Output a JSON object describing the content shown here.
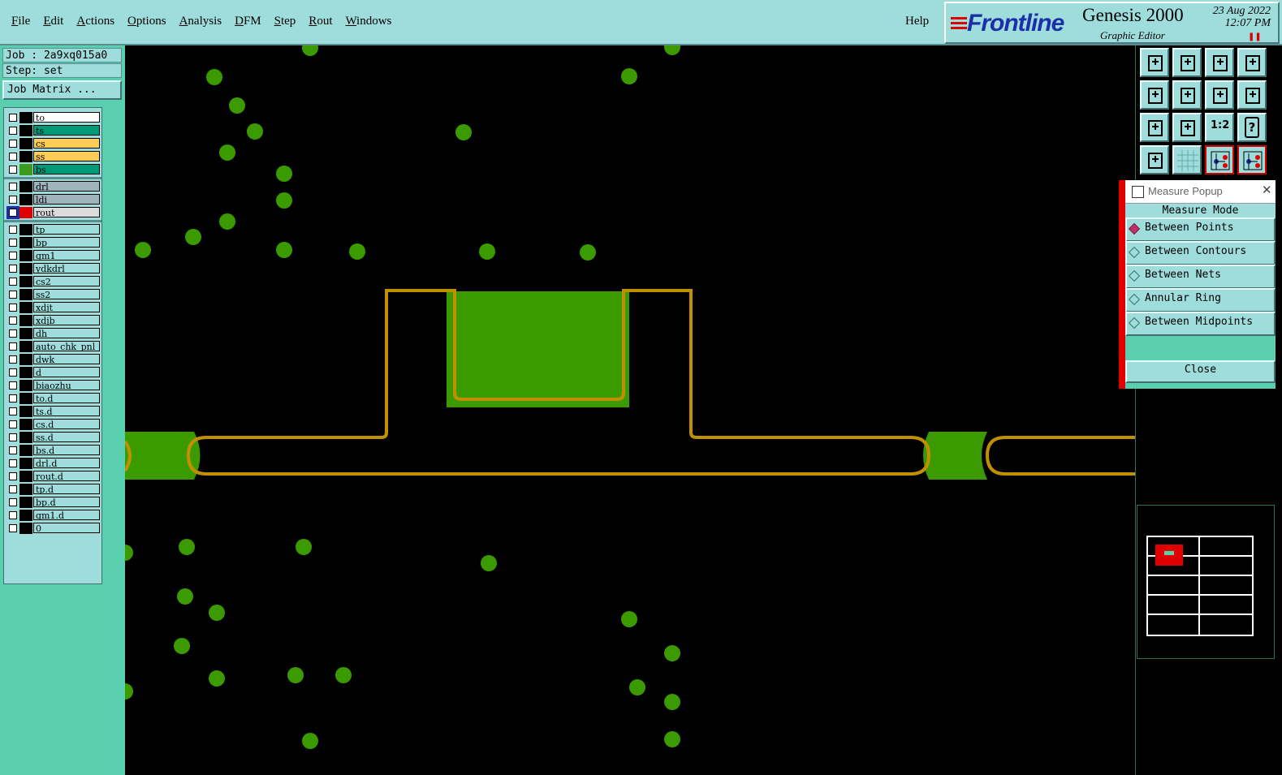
{
  "menubar": {
    "items": [
      "File",
      "Edit",
      "Actions",
      "Options",
      "Analysis",
      "DFM",
      "Step",
      "Rout",
      "Windows"
    ],
    "help": "Help"
  },
  "branding": {
    "logo": "Frontline",
    "app_name": "Genesis 2000",
    "subtitle": "Graphic Editor",
    "date": "23 Aug 2022",
    "time": "12:07 PM"
  },
  "job": {
    "job_label": "Job : 2a9xq015a0",
    "step_label": "Step: set",
    "matrix_button": "Job Matrix ..."
  },
  "layers": [
    {
      "name": "to",
      "color": "#ffffff",
      "group": 1
    },
    {
      "name": "ts",
      "color": "#009a78",
      "group": 1
    },
    {
      "name": "cs",
      "color": "#ffcc55",
      "group": 1
    },
    {
      "name": "ss",
      "color": "#ffcc55",
      "group": 1
    },
    {
      "name": "bs",
      "color": "#009a78",
      "group": 1,
      "swatch": "#3a9a20"
    },
    {
      "name": "drl",
      "color": "#9fb4bc",
      "group": 2
    },
    {
      "name": "ldi",
      "color": "#9fb4bc",
      "group": 2
    },
    {
      "name": "rout",
      "color": "#dcdcdc",
      "group": 2,
      "swatch": "#e00000",
      "active": true
    },
    {
      "name": "tp",
      "color": "#9fdcdc",
      "group": 3
    },
    {
      "name": "bp",
      "color": "#9fdcdc",
      "group": 3
    },
    {
      "name": "gm1",
      "color": "#9fdcdc",
      "group": 3
    },
    {
      "name": "ydkdrl",
      "color": "#9fdcdc",
      "group": 3
    },
    {
      "name": "cs2",
      "color": "#9fdcdc",
      "group": 3
    },
    {
      "name": "ss2",
      "color": "#9fdcdc",
      "group": 3
    },
    {
      "name": "xdjt",
      "color": "#9fdcdc",
      "group": 3
    },
    {
      "name": "xdjb",
      "color": "#9fdcdc",
      "group": 3
    },
    {
      "name": "dh",
      "color": "#9fdcdc",
      "group": 3
    },
    {
      "name": "auto_chk_pnl",
      "color": "#9fdcdc",
      "group": 3
    },
    {
      "name": "dwk",
      "color": "#9fdcdc",
      "group": 3
    },
    {
      "name": "d",
      "color": "#9fdcdc",
      "group": 3
    },
    {
      "name": "biaozhu",
      "color": "#9fdcdc",
      "group": 3
    },
    {
      "name": "to.d",
      "color": "#9fdcdc",
      "group": 3
    },
    {
      "name": "ts.d",
      "color": "#9fdcdc",
      "group": 3
    },
    {
      "name": "cs.d",
      "color": "#9fdcdc",
      "group": 3
    },
    {
      "name": "ss.d",
      "color": "#9fdcdc",
      "group": 3
    },
    {
      "name": "bs.d",
      "color": "#9fdcdc",
      "group": 3
    },
    {
      "name": "drl.d",
      "color": "#9fdcdc",
      "group": 3
    },
    {
      "name": "rout.d",
      "color": "#9fdcdc",
      "group": 3
    },
    {
      "name": "tp.d",
      "color": "#9fdcdc",
      "group": 3
    },
    {
      "name": "bp.d",
      "color": "#9fdcdc",
      "group": 3
    },
    {
      "name": "gm1.d",
      "color": "#9fdcdc",
      "group": 3
    },
    {
      "name": "0",
      "color": "#9fdcdc",
      "group": 3
    }
  ],
  "toolbar_icons": [
    "open-icon",
    "save-icon",
    "home-icon",
    "panel-icon",
    "import-icon",
    "export-icon",
    "undo-icon",
    "redraw-icon",
    "fit-icon",
    "zoom-icon",
    "scale-icon",
    "help-icon",
    "settings-icon",
    "grid-icon",
    "snap-icon",
    "snap2-icon"
  ],
  "toolbar_labels": {
    "scale": "1:2",
    "help": "?"
  },
  "measure": {
    "title": "Measure Popup",
    "close_x": "✕",
    "mode_header": "Measure Mode",
    "options": [
      "Between Points",
      "Between Contours",
      "Between Nets",
      "Annular Ring",
      "Between Midpoints"
    ],
    "selected": 0,
    "close": "Close"
  },
  "colors": {
    "pad": "#3a9a00",
    "rout": "#c09000",
    "panel": "#9fdcdc",
    "accent": "#5acfb0"
  }
}
